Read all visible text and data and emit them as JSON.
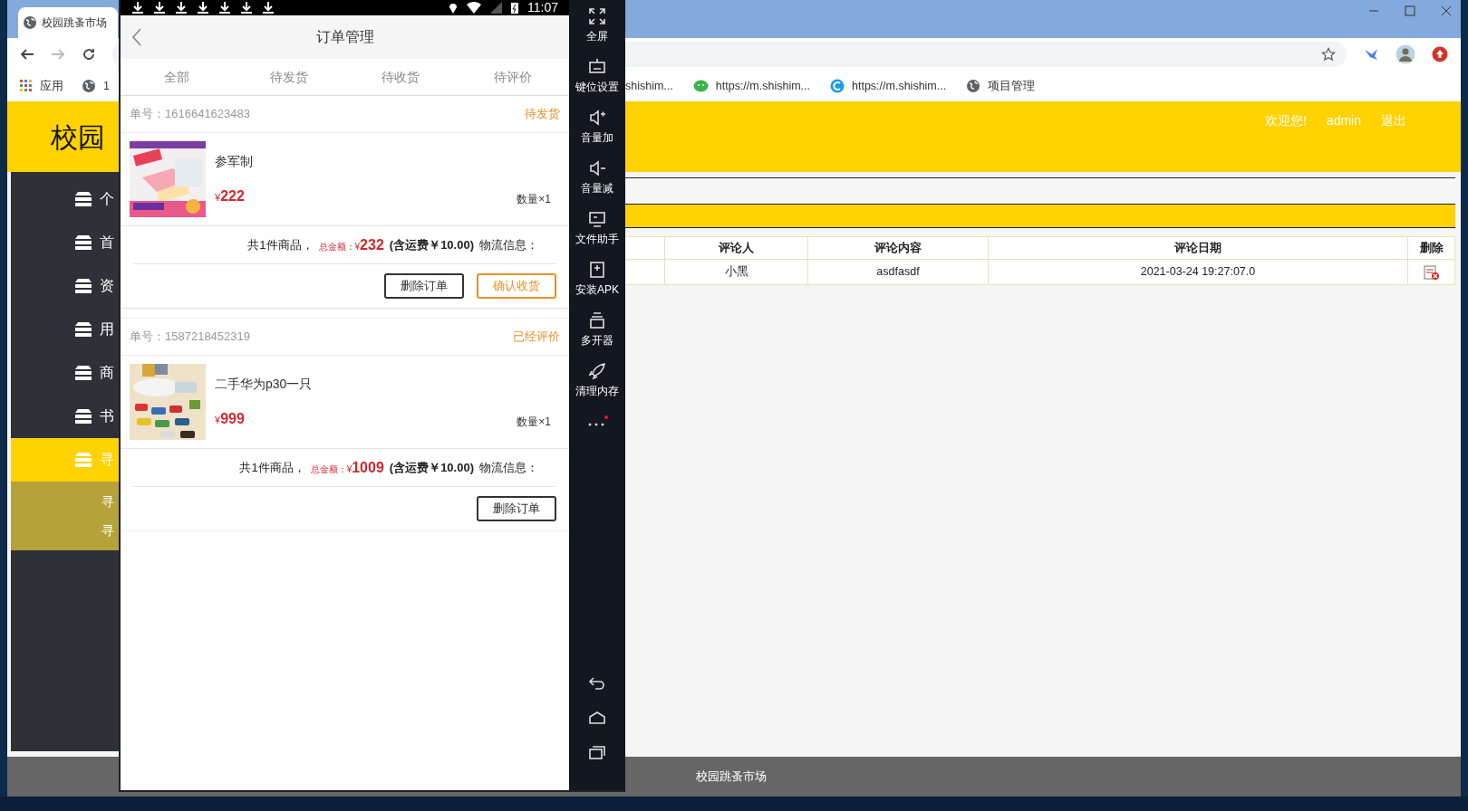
{
  "browser": {
    "tab_title": "校园跳蚤市场",
    "bookmarks_left": [
      {
        "label": "应用",
        "kind": "apps"
      },
      {
        "label": "1",
        "kind": "globe"
      }
    ],
    "bookmarks_right": [
      {
        "label": "shishim...",
        "kind": "none"
      },
      {
        "label": "https://m.shishim...",
        "kind": "chat"
      },
      {
        "label": "https://m.shishim...",
        "kind": "c"
      },
      {
        "label": "项目管理",
        "kind": "globe"
      }
    ]
  },
  "site": {
    "logo": "校园",
    "welcome": "欢迎您!",
    "user": "admin",
    "logout": "退出",
    "footer": "校园跳蚤市场"
  },
  "sidebar": {
    "items": [
      {
        "label": "个",
        "selected": false
      },
      {
        "label": "首",
        "selected": false
      },
      {
        "label": "资",
        "selected": false
      },
      {
        "label": "用",
        "selected": false
      },
      {
        "label": "商",
        "selected": false
      },
      {
        "label": "书",
        "selected": false
      },
      {
        "label": "寻",
        "selected": true,
        "children": [
          {
            "label": "寻"
          },
          {
            "label": "寻"
          }
        ]
      }
    ]
  },
  "table": {
    "columns": [
      "评论人",
      "评论内容",
      "评论日期",
      "删除"
    ],
    "rows": [
      [
        "小黑",
        "asdfasdf",
        "2021-03-24 19:27:07.0"
      ]
    ]
  },
  "phone": {
    "time": "11:07",
    "title": "订单管理",
    "tabs": [
      "全部",
      "待发货",
      "待收货",
      "待评价"
    ],
    "orders": [
      {
        "number": "单号：1616641623483",
        "status": "待发货",
        "product": "参军制",
        "currency": "¥",
        "price": "222",
        "quantity": "数量×1",
        "count_text": "共1件商品，",
        "total_label": "总金额：¥",
        "total": "232",
        "shipping": "(含运费￥10.00)",
        "logistics": "物流信息：",
        "buttons": [
          {
            "label": "删除订单",
            "kind": "plain"
          },
          {
            "label": "确认收货",
            "kind": "primary"
          }
        ]
      },
      {
        "number": "单号：1587218452319",
        "status": "已经评价",
        "product": "二手华为p30一只",
        "currency": "¥",
        "price": "999",
        "quantity": "数量×1",
        "count_text": "共1件商品，",
        "total_label": "总金额：¥",
        "total": "1009",
        "shipping": "(含运费￥10.00)",
        "logistics": "物流信息：",
        "buttons": [
          {
            "label": "删除订单",
            "kind": "plain"
          }
        ]
      }
    ]
  },
  "emulator_tools": [
    {
      "label": "全屏",
      "kind": "fullscreen"
    },
    {
      "label": "键位设置",
      "kind": "keyboard"
    },
    {
      "label": "音量加",
      "kind": "volup"
    },
    {
      "label": "音量减",
      "kind": "voldown"
    },
    {
      "label": "文件助手",
      "kind": "monitor"
    },
    {
      "label": "安装APK",
      "kind": "apk"
    },
    {
      "label": "多开器",
      "kind": "multi"
    },
    {
      "label": "清理内存",
      "kind": "rocket"
    }
  ]
}
